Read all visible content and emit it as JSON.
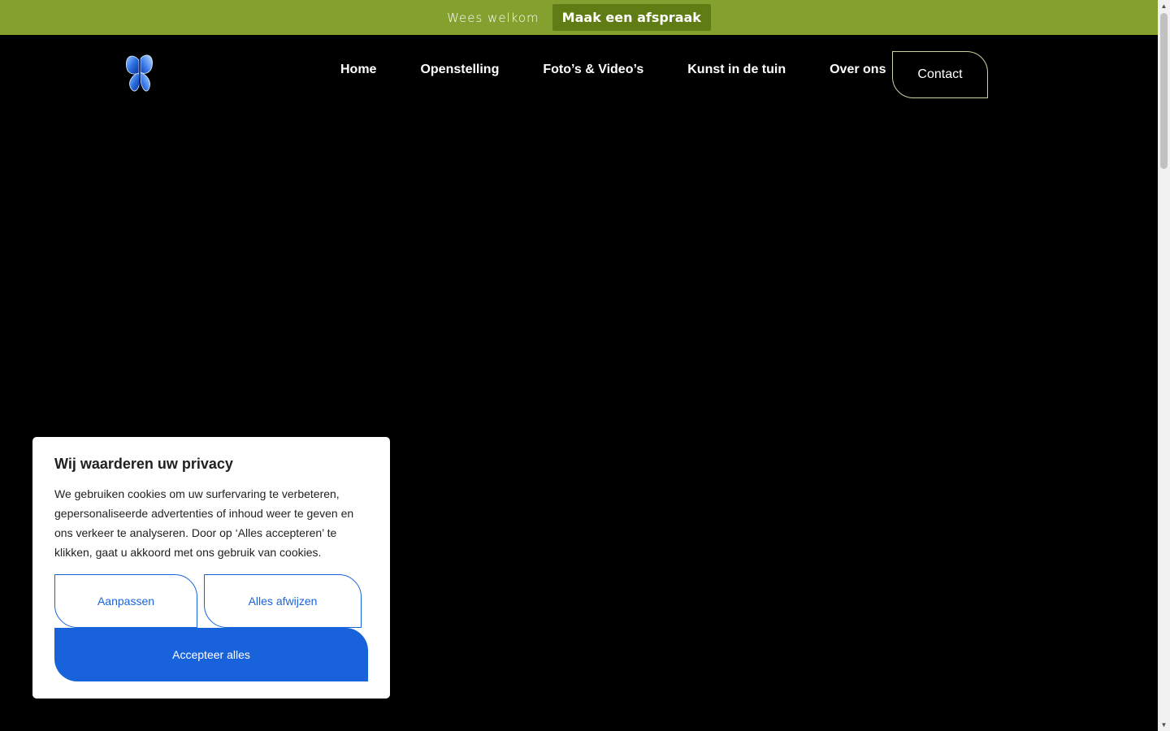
{
  "topbar": {
    "welcome_text": "Wees welkom",
    "cta_label": "Maak een afspraak",
    "bg_color": "#84a02f",
    "cta_color": "#5f7d14"
  },
  "header": {
    "logo_icon": "butterfly-icon",
    "nav": [
      {
        "label": "Home"
      },
      {
        "label": "Openstelling"
      },
      {
        "label": "Foto’s & Video’s"
      },
      {
        "label": "Kunst in de tuin"
      },
      {
        "label": "Over ons"
      }
    ],
    "contact_label": "Contact"
  },
  "cookie_banner": {
    "title": "Wij waarderen uw privacy",
    "body": "We gebruiken cookies om uw surfervaring te verbeteren, gepersonaliseerde advertenties of inhoud weer te geven en ons verkeer te analyseren. Door op ‘Alles accepteren’ te klikken, gaat u akkoord met ons gebruik van cookies.",
    "customize_label": "Aanpassen",
    "reject_label": "Alles afwijzen",
    "accept_label": "Accepteer alles",
    "accent_color": "#1863dc"
  }
}
